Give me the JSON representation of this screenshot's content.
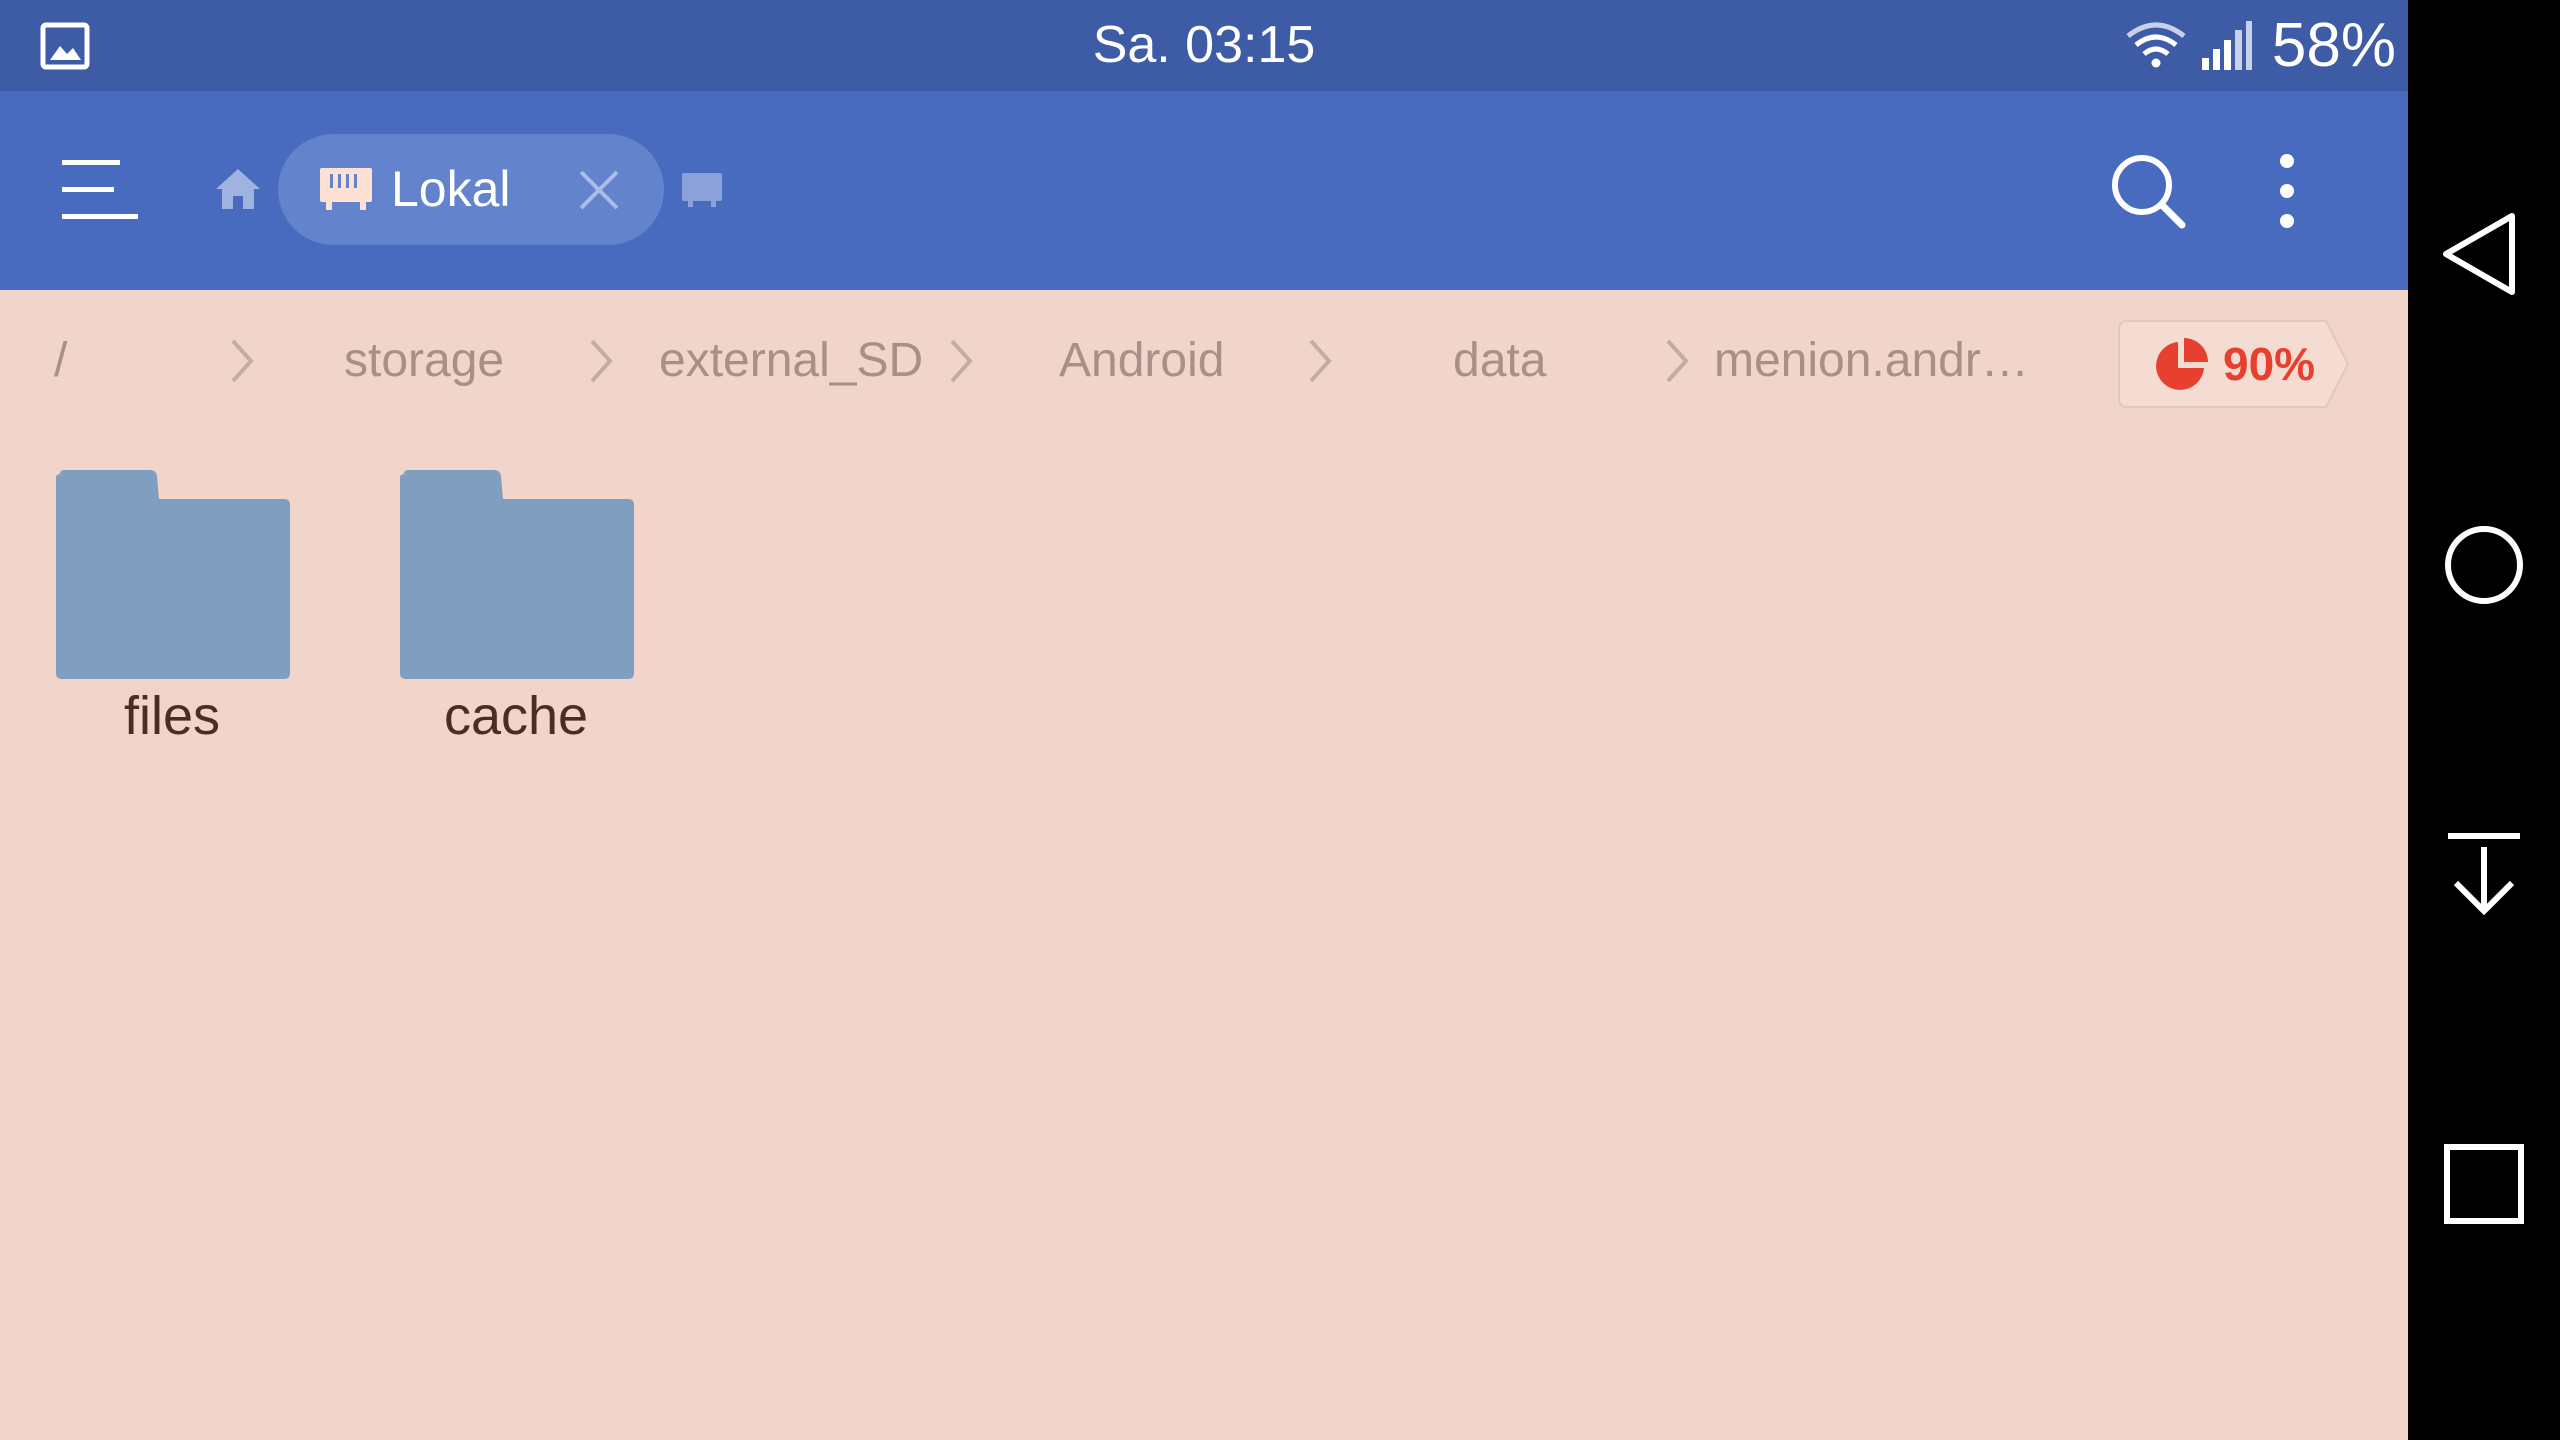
{
  "status_bar": {
    "time": "Sa. 03:15",
    "battery": "58%",
    "icons": [
      "gallery-notification-icon",
      "wifi-icon",
      "signal-icon"
    ]
  },
  "toolbar": {
    "tab_label": "Lokal",
    "icons": [
      "menu-icon",
      "home-icon",
      "sd-card-icon",
      "close-icon",
      "sd-card-icon",
      "search-icon",
      "more-vert-icon"
    ]
  },
  "breadcrumb": {
    "items": [
      "/",
      "storage",
      "external_SD",
      "Android",
      "data",
      "menion.andr…"
    ],
    "storage_usage": "90%"
  },
  "files": [
    {
      "name": "files",
      "icon": "folder-icon"
    },
    {
      "name": "cache",
      "icon": "folder-icon"
    }
  ],
  "nav_bar": {
    "buttons": [
      "back-icon",
      "home-circle-icon",
      "download-icon",
      "recents-icon"
    ]
  },
  "colors": {
    "status_bar": "#3e5ba6",
    "toolbar": "#486bbf",
    "tab_chip": "#6383cc",
    "background": "#f2d5ca",
    "folder": "#7f9ec0",
    "breadcrumb_text": "#a88f87",
    "accent_red": "#e8402e"
  }
}
